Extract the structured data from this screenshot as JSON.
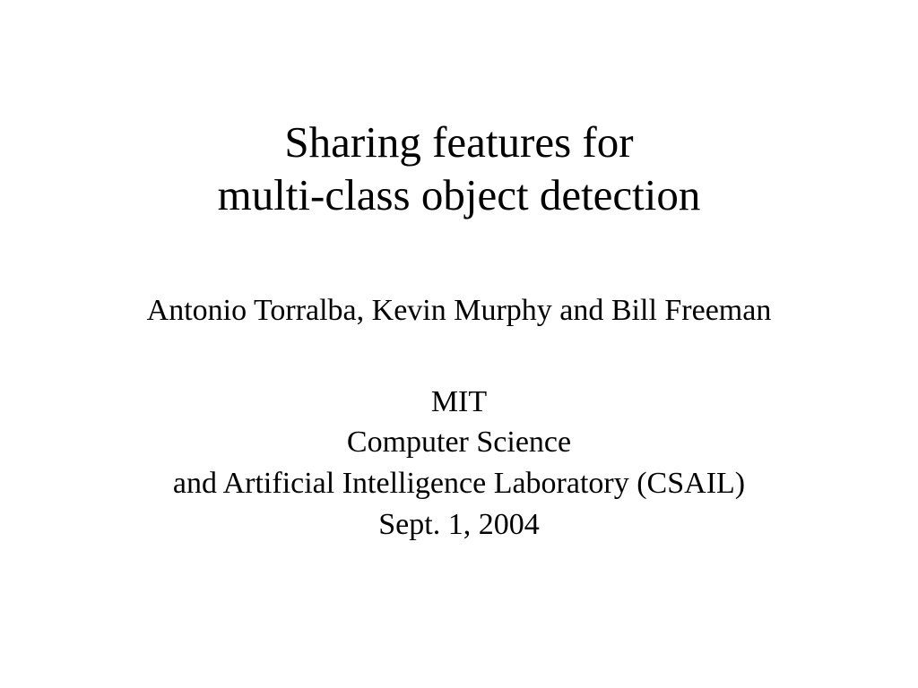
{
  "slide": {
    "title_line1": "Sharing features for",
    "title_line2": "multi-class object detection",
    "authors": "Antonio Torralba, Kevin Murphy and Bill Freeman",
    "affiliation_line1": "MIT",
    "affiliation_line2": "Computer Science",
    "affiliation_line3": "and Artificial Intelligence Laboratory (CSAIL)",
    "date": "Sept. 1, 2004"
  }
}
